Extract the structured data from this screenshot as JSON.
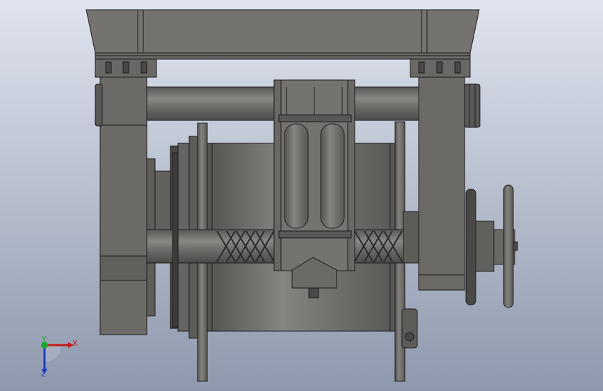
{
  "viewport": {
    "background_top": "#dfe4ee",
    "background_bottom": "#8e98ad"
  },
  "model": {
    "body_color": "#6e6c69",
    "edge_color": "#1c1c1c",
    "highlight_color": "#8a8884"
  },
  "triad": {
    "x_label": "X",
    "y_label": "Y",
    "z_label": "Z",
    "x_color": "#c41a1a",
    "y_color": "#1aa82a",
    "z_color": "#1a3ac4"
  }
}
